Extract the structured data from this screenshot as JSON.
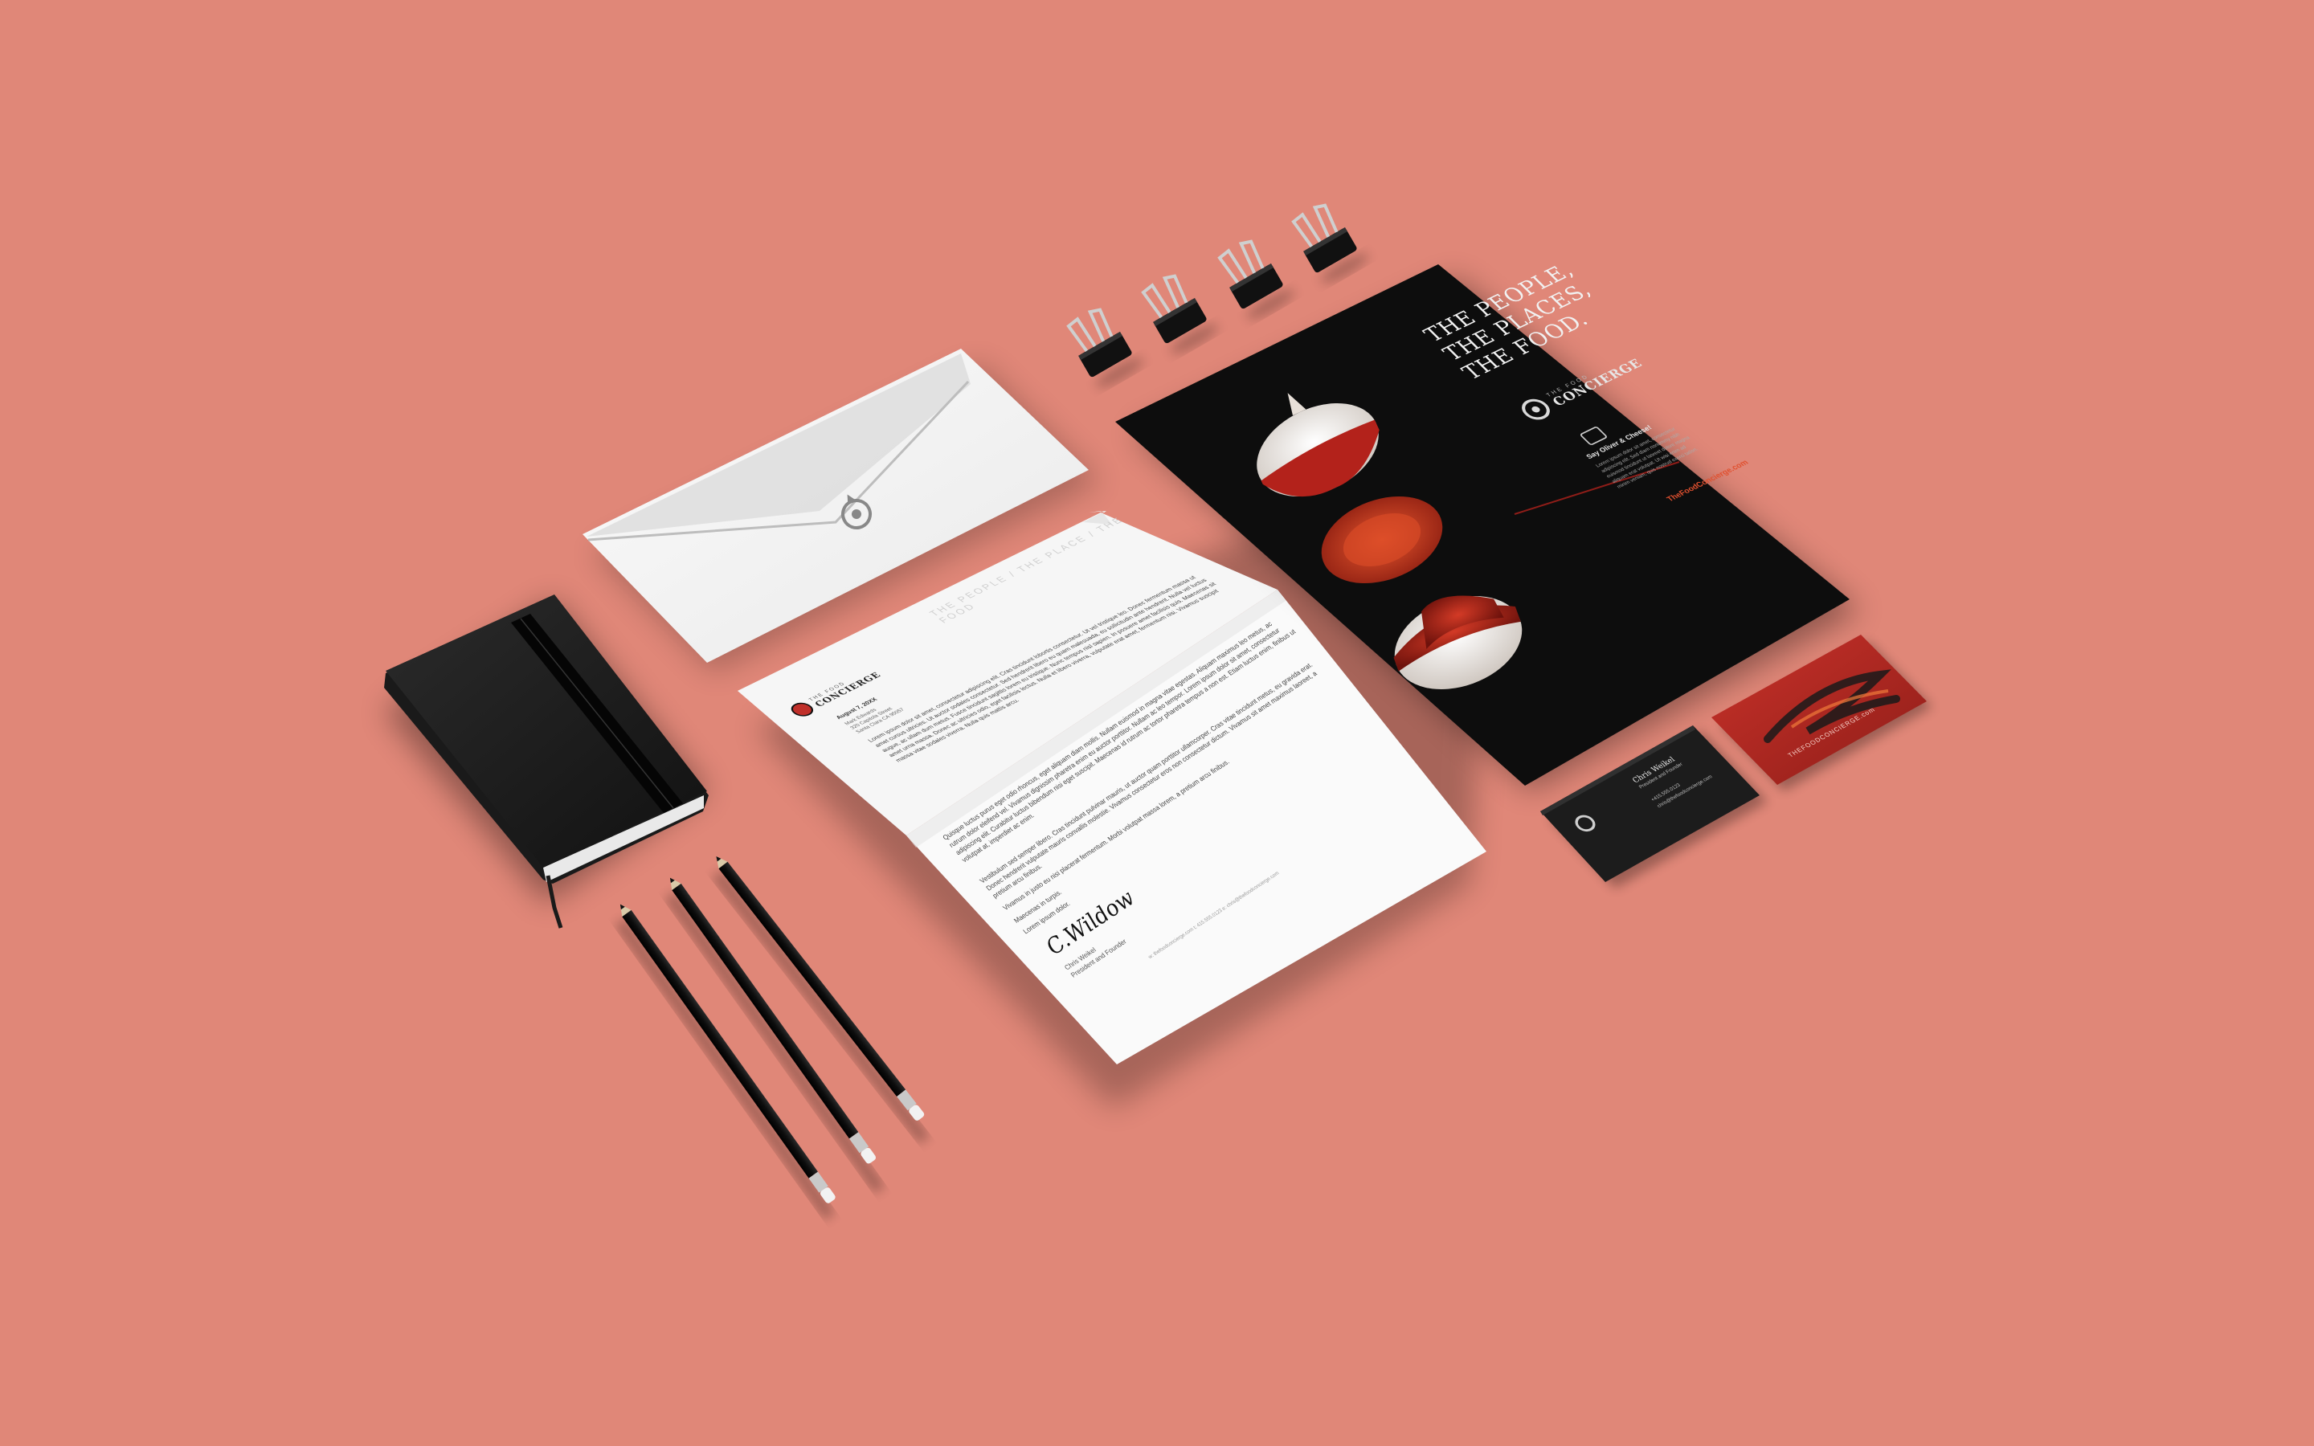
{
  "colors": {
    "background": "#e08778",
    "brand_red": "#c0302a",
    "brand_orange": "#e0502f",
    "black": "#111111",
    "paper": "#f4f4f4"
  },
  "letter": {
    "header_tagline": "THE PEOPLE / THE PLACE / THE FOOD",
    "logo_small": "THE FOOD",
    "logo_name": "CONCIERGE",
    "date": "August 7, 20XX",
    "recipient_lines": [
      "Mark Edwards",
      "320 Capitola Street",
      "Santa Clara CA 95057"
    ],
    "paragraphs": [
      "Lorem ipsum dolor sit amet, consectetur adipiscing elit. Cras tincidunt lobortis consectetur. Ut vel tristique leo. Donec fermentum massa ut amet cursus ultricies. Ut auctor sodales consectetur. Sed hendrerit libero eu quam malesuada, eu sollicitudin ante hendrerit. Nulla vel luctus augue, ac ullam dum metus. Fusce tincidunt sagittis lorem eu tristique. Nunc tempus nisl sapien. In posuere amet facilisis quis. Maecenas sit amet urna massa. Donec ac ultricies odio, eget facilisis lectus. Nulla et libero viverra, vulputate erat amet, fermentum nisi. Vivamus suscipit massa vitae sodales viverra. Nulla quis mattis arcu.",
      "Quisque luctus purus eget odio rhoncus, eget aliquam diam mollis. Nullam euismod in magna vitae egestas. Aliquam maximus leo metus, ac rutrum dolor eleifend vel. Vivamus dignissim pharetra enim eu auctor porttitor. Nullam ac leo tempor. Lorem ipsum dolor sit amet, consectetur adipiscing elit. Curabitur luctus bibendum nisi eget suscipit. Maecenas id rutrum ac tortor pharetra tempus a non est. Etiam luctus enim, finibus ut volutpat at, imperdiet ac enim.",
      "Vestibulum sed semper libero. Cras tincidunt pulvinar mauris, ut auctor quam porttitor ullamcorper. Cras vitae tincidunt metus, eu gravida erat. Donec hendrerit vulputate mauris convallis molestie. Vivamus consectetur eros non consectetur dictum. Vivamus sit amet maximus laoreet, a pretium arcu finibus.",
      "Vivamus in justo eu nisi placerat fermentum. Morbi volutpat massa lorem, a pretium arcu finibus.",
      "Maecenas in turpis.",
      "Lorem ipsum dolor."
    ],
    "signature": "C.Wildow",
    "signer_name": "Chris Weikel",
    "signer_title": "President and Founder",
    "footer": "w: thefoodconcierge.com    t: 415.555.0123    e: chris@thefoodconcierge.com"
  },
  "poster": {
    "headline_lines": [
      "THE PEOPLE,",
      "THE PLACES,",
      "THE FOOD."
    ],
    "logo_small": "THE FOOD",
    "logo_name": "CONCIERGE",
    "social_heading": "Say Oliver & Cheese!",
    "body_lines": [
      "Lorem ipsum dolor sit amet, consectetur",
      "adipiscing elit. Sed diam nonummy nibh",
      "euismod tincidunt ut laoreet dolore magna",
      "aliquam erat volutpat. Ut wisi enim ad",
      "minim veniam, quis nostrud exerci tation."
    ],
    "url": "TheFoodConcierge.com"
  },
  "card_back": {
    "name": "Chris Weikel",
    "title": "President and Founder",
    "phone": "+415.555.0123",
    "email": "chris@thefoodconcierge.com"
  },
  "card_front": {
    "url": "THEFOODCONCIERGE.com"
  }
}
